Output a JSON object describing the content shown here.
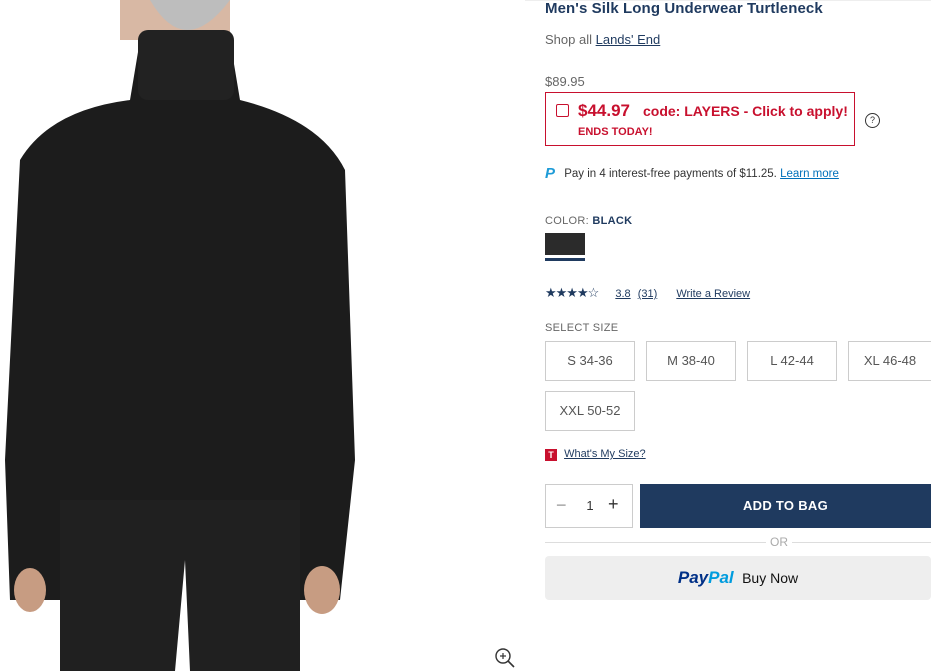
{
  "product": {
    "title": "Men's Silk Long Underwear Turtleneck",
    "shop_all_prefix": "Shop all",
    "brand_link": "Lands' End",
    "price": "$89.95"
  },
  "promo": {
    "sale_price": "$44.97",
    "code_text": "code: LAYERS - Click to apply!",
    "ends": "ENDS TODAY!",
    "help_glyph": "?"
  },
  "paypal_message": {
    "text": "Pay in 4 interest-free payments of $11.25.",
    "link": "Learn more"
  },
  "color": {
    "label": "COLOR:",
    "value": "BLACK",
    "swatch_hex": "#2b2b2b"
  },
  "rating": {
    "stars": "★★★★☆",
    "value": 3.8,
    "value_text": "3.8",
    "count": "(31)",
    "write_review": "Write a Review"
  },
  "sizes": {
    "label": "SELECT SIZE",
    "options": [
      "S 34-36",
      "M 38-40",
      "L 42-44",
      "XL 46-48",
      "XXL 50-52"
    ],
    "whats_my_size": "What's My Size?"
  },
  "quantity": {
    "value": "1",
    "minus": "−",
    "plus": "+"
  },
  "buttons": {
    "add_to_bag": "ADD TO BAG",
    "or": "OR",
    "paypal_logo_a": "Pay",
    "paypal_logo_b": "Pal",
    "paypal_buy_now": "Buy Now"
  },
  "colors": {
    "navy": "#1f3a5f",
    "red": "#c8102e"
  }
}
